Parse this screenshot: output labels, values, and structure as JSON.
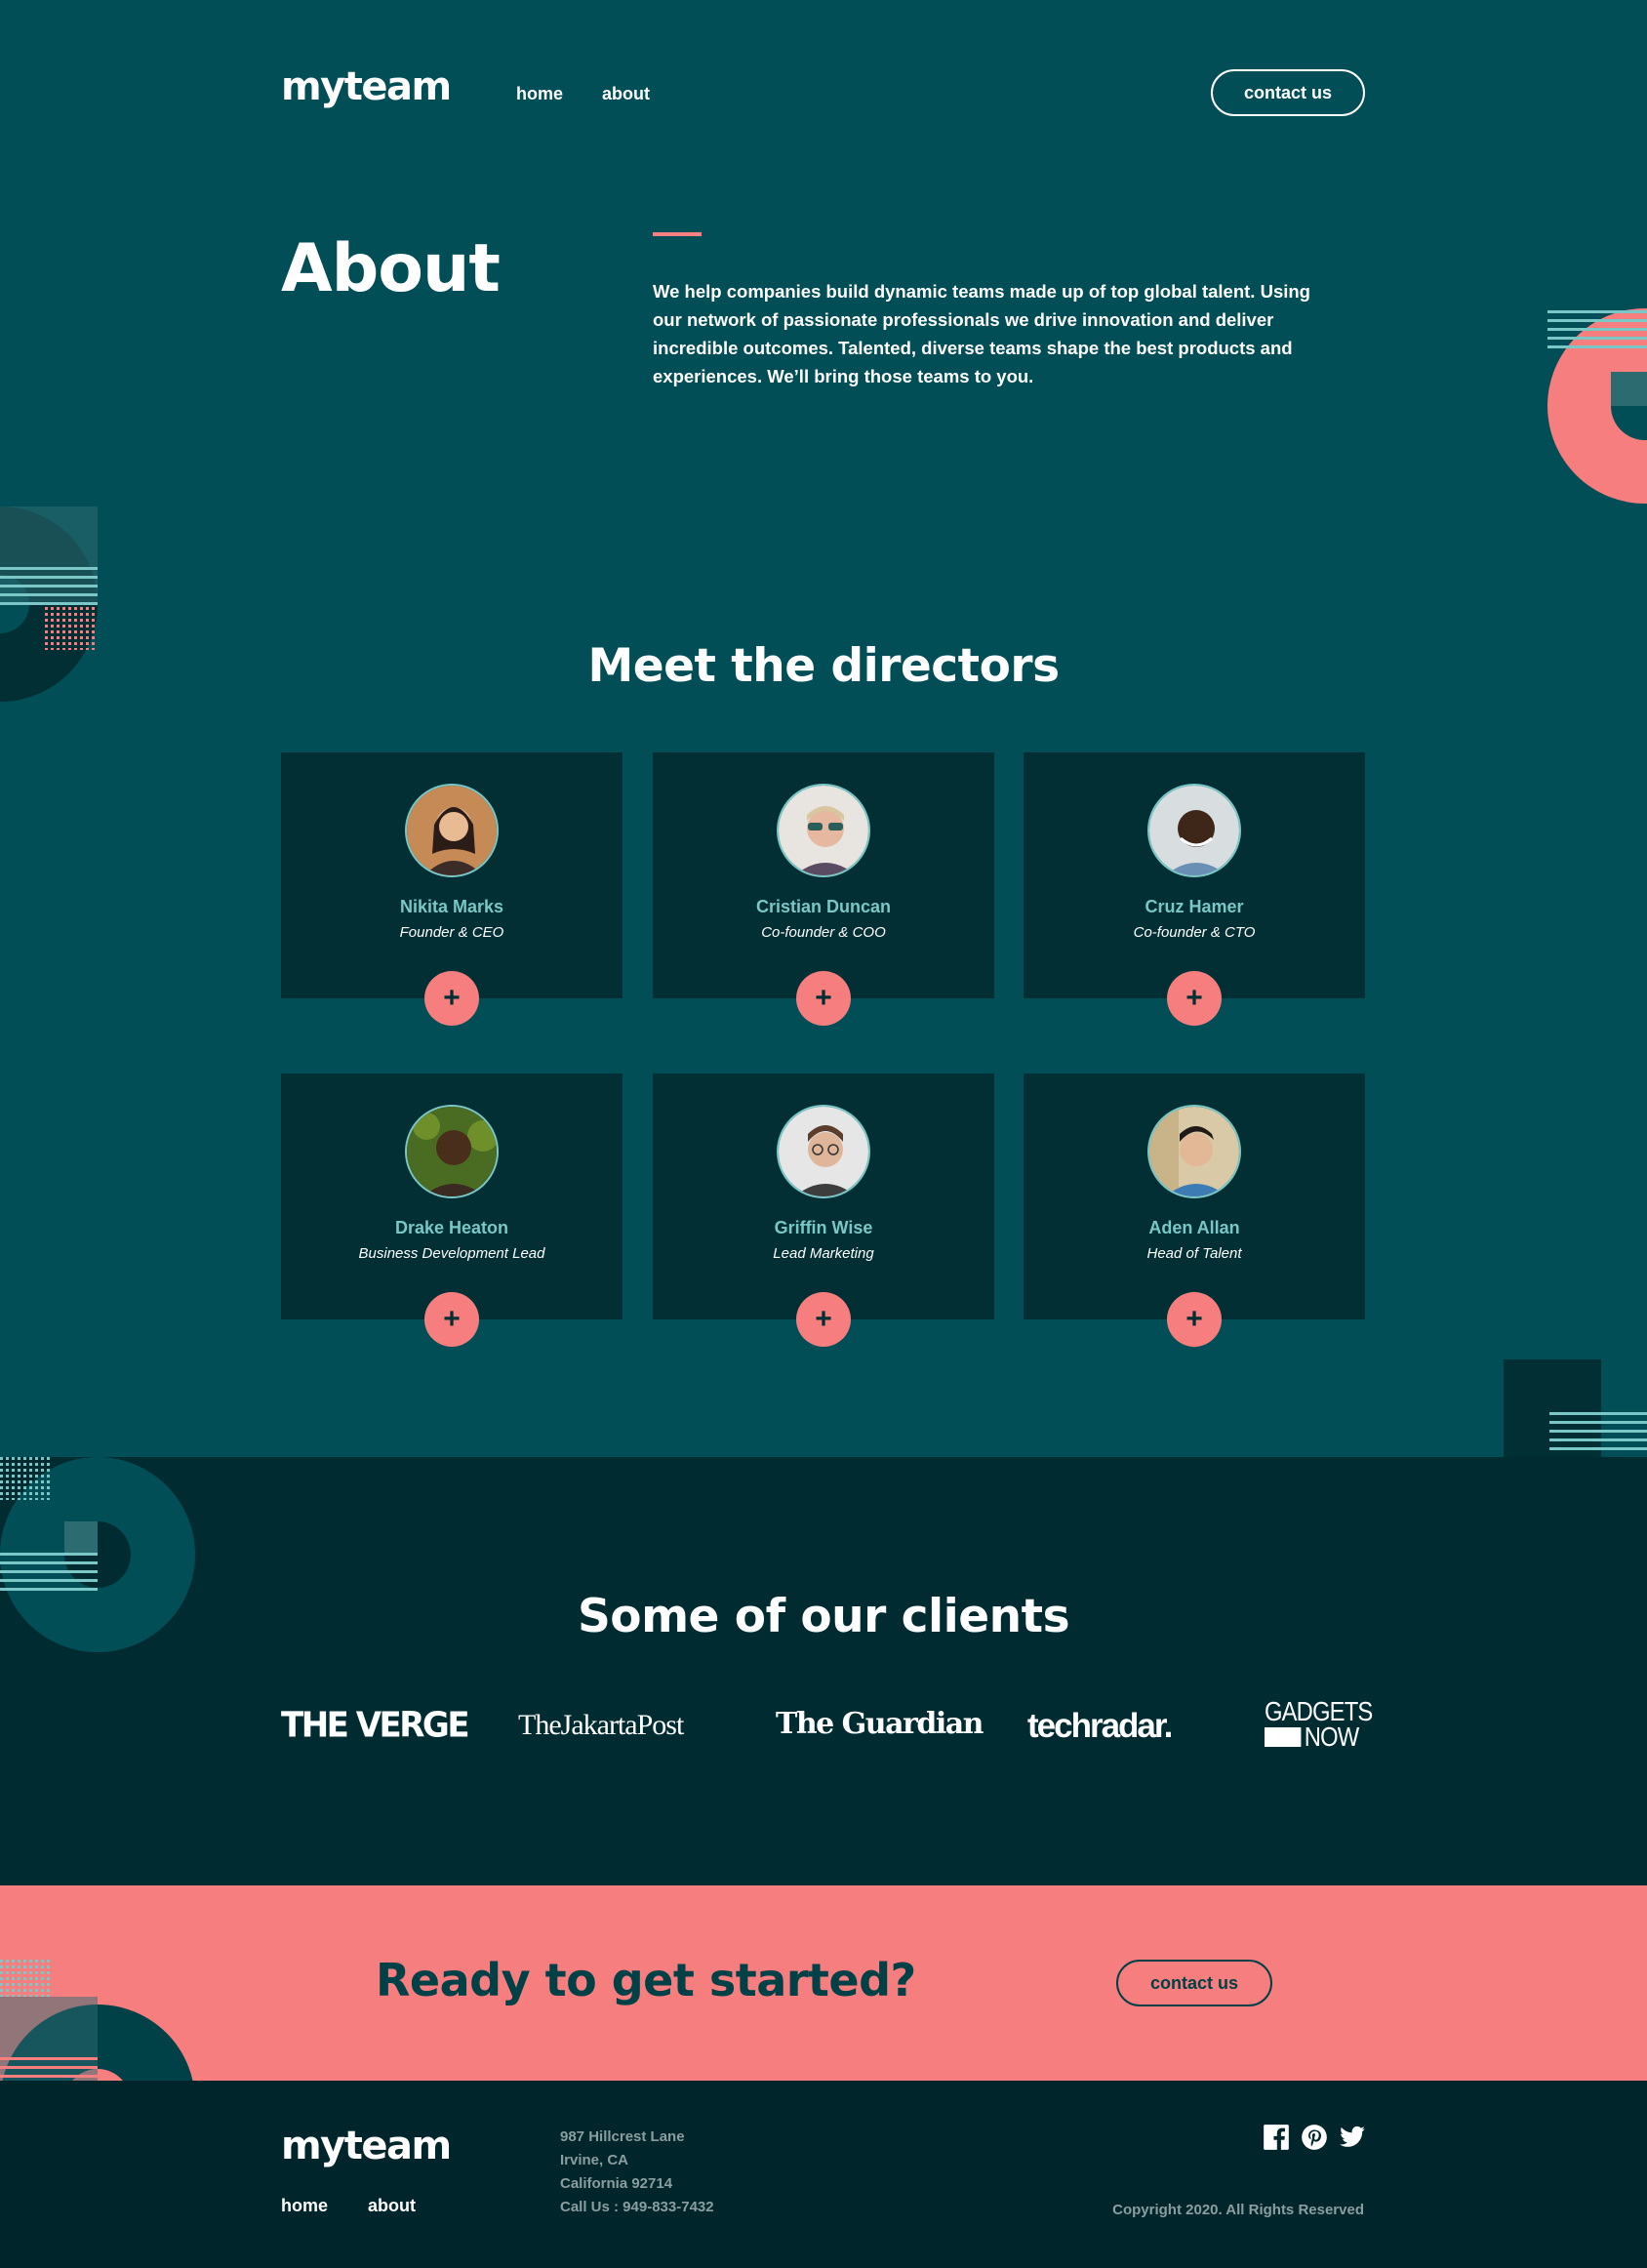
{
  "header": {
    "logo": "myteam",
    "nav": [
      "home",
      "about"
    ],
    "contact_label": "contact us"
  },
  "hero": {
    "title": "About",
    "text": "We help companies build dynamic teams made up of top global talent. Using our network of passionate professionals we drive innovation and deliver incredible outcomes. Talented, diverse teams shape the best products and experiences. We’ll bring those teams to you."
  },
  "directors": {
    "title": "Meet the directors",
    "people": [
      {
        "name": "Nikita Marks",
        "role": "Founder & CEO"
      },
      {
        "name": "Cristian Duncan",
        "role": "Co-founder & COO"
      },
      {
        "name": "Cruz Hamer",
        "role": "Co-founder & CTO"
      },
      {
        "name": "Drake Heaton",
        "role": "Business Development Lead"
      },
      {
        "name": "Griffin Wise",
        "role": "Lead Marketing"
      },
      {
        "name": "Aden Allan",
        "role": "Head of Talent"
      }
    ],
    "plus_label": "+"
  },
  "clients": {
    "title": "Some of our clients",
    "logos": [
      "THE VERGE",
      "TheJakartaPost",
      "The Guardian",
      "techradar.",
      "GADGETS",
      "NOW"
    ]
  },
  "cta": {
    "title": "Ready to get started?",
    "button": "contact us"
  },
  "footer": {
    "logo": "myteam",
    "nav": [
      "home",
      "about"
    ],
    "address": [
      "987 Hillcrest Lane",
      "Irvine, CA",
      "California 92714",
      "Call Us : 949-833-7432"
    ],
    "copyright": "Copyright 2020. All Rights Reserved",
    "social": [
      "facebook-icon",
      "pinterest-icon",
      "twitter-icon"
    ]
  },
  "colors": {
    "primary": "#014e56",
    "dark": "#012f34",
    "darker": "#002c31",
    "coral": "#f67e7e",
    "teal": "#79c8c7"
  }
}
